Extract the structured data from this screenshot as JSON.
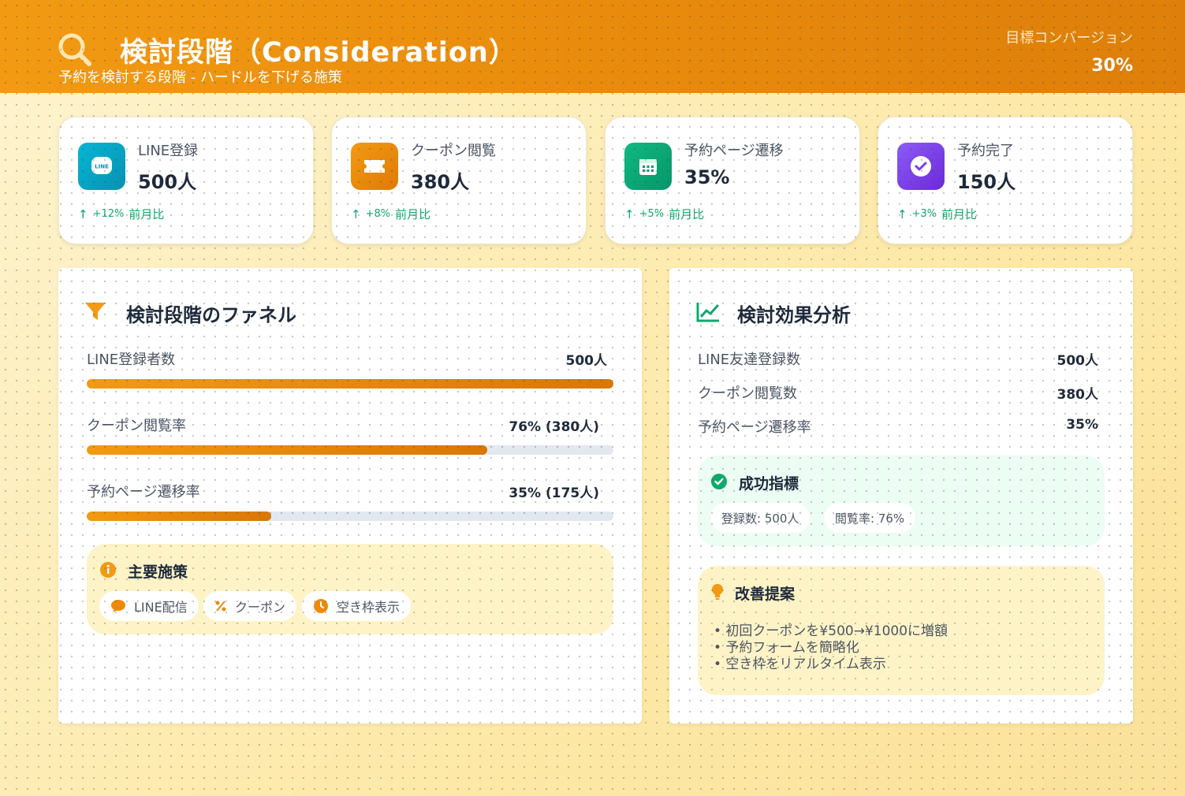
{
  "header": {
    "title": "検討段階（Consideration）",
    "subtitle": "予約を検討する段階 - ハードルを下げる施策",
    "target_label": "目標コンバージョン",
    "target_value": "30%"
  },
  "stats": [
    {
      "label": "LINE登録",
      "value": "500人",
      "delta": "+12%",
      "delta_suffix": "前月比",
      "icon": "line-icon",
      "color": "#0ea5c6"
    },
    {
      "label": "クーポン閲覧",
      "value": "380人",
      "delta": "+8%",
      "delta_suffix": "前月比",
      "icon": "ticket-icon",
      "color": "#ee8a0b"
    },
    {
      "label": "予約ページ遷移",
      "value": "35%",
      "delta": "+5%",
      "delta_suffix": "前月比",
      "icon": "calendar-icon",
      "color": "#10a86b"
    },
    {
      "label": "予約完了",
      "value": "150人",
      "delta": "+3%",
      "delta_suffix": "前月比",
      "icon": "check-circle-icon",
      "color": "#7c3aed"
    }
  ],
  "funnel": {
    "title": "検討段階のファネル",
    "rows": [
      {
        "label": "LINE登録者数",
        "value": "500人",
        "fill": 1.0
      },
      {
        "label": "クーポン閲覧率",
        "value": "76% (380人)",
        "fill": 0.76
      },
      {
        "label": "予約ページ遷移率",
        "value": "35% (175人)",
        "fill": 0.35
      }
    ],
    "measures_title": "主要施策",
    "measures": [
      "LINE配信",
      "クーポン",
      "空き枠表示"
    ]
  },
  "analysis": {
    "title": "検討効果分析",
    "metrics": [
      {
        "label": "LINE友達登録数",
        "value": "500人"
      },
      {
        "label": "クーポン閲覧数",
        "value": "380人"
      },
      {
        "label": "予約ページ遷移率",
        "value": "35%"
      }
    ],
    "success_title": "成功指標",
    "success_pills": [
      "登録数: 500人",
      "閲覧率: 76%"
    ],
    "improve_title": "改善提案",
    "improve_items": [
      "• 初回クーポンを¥500→¥1000に増額",
      "• 予約フォームを簡略化",
      "• 空き枠をリアルタイム表示"
    ]
  }
}
